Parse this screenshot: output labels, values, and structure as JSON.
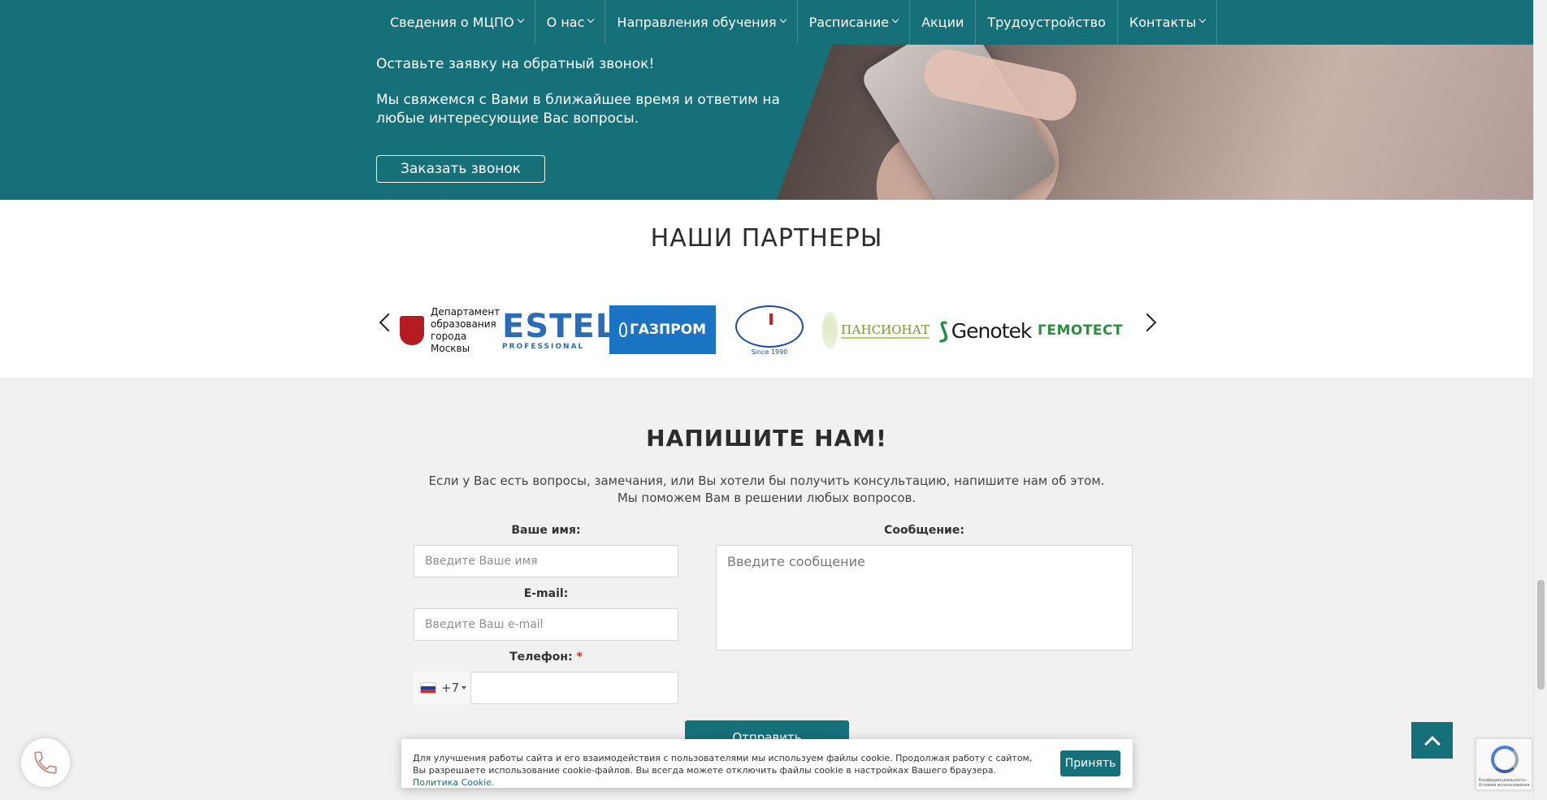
{
  "nav": {
    "items": [
      {
        "label": "Сведения о МЦПО",
        "has_dropdown": true
      },
      {
        "label": "О нас",
        "has_dropdown": true
      },
      {
        "label": "Направления обучения",
        "has_dropdown": true
      },
      {
        "label": "Расписание",
        "has_dropdown": true
      },
      {
        "label": "Акции",
        "has_dropdown": false
      },
      {
        "label": "Трудоустройство",
        "has_dropdown": false
      },
      {
        "label": "Контакты",
        "has_dropdown": true
      }
    ]
  },
  "callback": {
    "line1": "Оставьте заявку на обратный звонок!",
    "line2": "Мы свяжемся с Вами в ближайшее время и ответим на любые интересующие Вас вопросы.",
    "button": "Заказать звонок"
  },
  "partners": {
    "title": "НАШИ ПАРТНЕРЫ",
    "moscow_text": "Департамент образования города Москвы",
    "estel_big": "ESTEL",
    "estel_small": "PROFESSIONAL",
    "gazprom": "ГАЗПРОМ",
    "medicine_caption": "Since 1990",
    "pansionat": "ПАНСИОНАТ",
    "genotek": "Genotek",
    "gemotest": "ГЕМОТЕСТ"
  },
  "contact": {
    "title": "НАПИШИТЕ НАМ!",
    "desc_line1": "Если у Вас есть вопросы, замечания, или Вы хотели бы получить консультацию, напишите нам об этом.",
    "desc_line2": "Мы поможем Вам в решении любых вопросов.",
    "name_label": "Ваше имя:",
    "name_placeholder": "Введите Ваше имя",
    "email_label": "E-mail:",
    "email_placeholder": "Введите Ваш e-mail",
    "phone_label": "Телефон:",
    "phone_required": "*",
    "phone_code": "+7",
    "message_label": "Сообщение:",
    "message_placeholder": "Введите сообщение",
    "submit": "Отправить"
  },
  "cookie": {
    "text": "Для улучшения работы сайта и его взаимодействия с пользователями мы используем файлы cookie. Продолжая работу с сайтом, Вы разрешаете использование cookie-файлов. Вы всегда можете отключить файлы cookie в настройках Вашего браузера.",
    "link": "Политика Cookie.",
    "accept": "Принять"
  },
  "recaptcha": {
    "text": "Конфиденциальность - Условия использования"
  },
  "colors": {
    "brand": "#16707a"
  },
  "icons": {
    "call": "phone-icon",
    "scroll_top": "chevron-up-icon"
  }
}
